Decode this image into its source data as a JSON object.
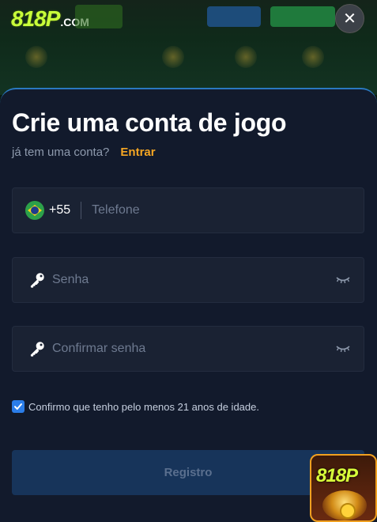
{
  "background": {
    "logo_number": "818P",
    "logo_domain": ".COM"
  },
  "close": {
    "glyph": "✕"
  },
  "form": {
    "title": "Crie uma conta de jogo",
    "have_account": "já tem uma conta?",
    "login_link": "Entrar",
    "phone": {
      "dial_code": "+55",
      "placeholder": "Telefone",
      "flag_icon": "brazil-flag-icon"
    },
    "password": {
      "placeholder": "Senha",
      "icon": "key-icon"
    },
    "confirm_password": {
      "placeholder": "Confirmar senha",
      "icon": "key-icon"
    },
    "age_confirm": {
      "checked": true,
      "text": "Confirmo que tenho pelo menos 21 anos de idade."
    },
    "submit_label": "Registro"
  },
  "promo": {
    "logo": "818P"
  },
  "colors": {
    "sheet_bg": "#121a2c",
    "accent_link": "#f5a623",
    "checkbox": "#2b7de9",
    "submit_bg": "#17345a"
  }
}
